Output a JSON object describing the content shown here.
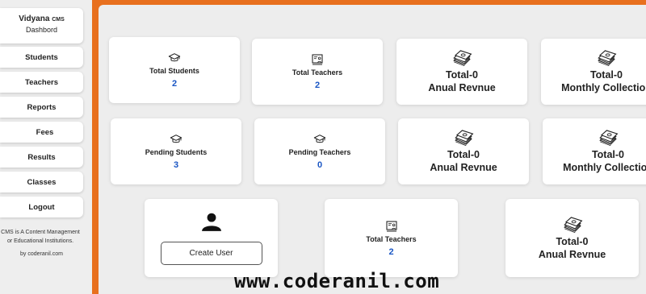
{
  "sidebar": {
    "brand_name": "Vidyana",
    "brand_suffix": "CMS",
    "brand_sub": "Dashbord",
    "items": [
      {
        "label": "Students"
      },
      {
        "label": "Teachers"
      },
      {
        "label": "Reports"
      },
      {
        "label": "Fees"
      },
      {
        "label": "Results"
      },
      {
        "label": "Classes"
      },
      {
        "label": "Logout"
      }
    ],
    "about_line1": "CMS is A Content Management",
    "about_line2": "or Educational Institutions.",
    "byline": "by coderanil.com"
  },
  "cards": {
    "total_students": {
      "label": "Total Students",
      "value": "2",
      "icon": "graduation-cap-icon"
    },
    "total_teachers": {
      "label": "Total Teachers",
      "value": "2",
      "icon": "chalkboard-teacher-icon"
    },
    "annual_revenue": {
      "line1": "Total-0",
      "line2": "Anual Revnue",
      "icon": "money-stack-icon"
    },
    "monthly_collection": {
      "line1": "Total-0",
      "line2": "Monthly Collection",
      "icon": "money-stack-icon"
    },
    "pending_students": {
      "label": "Pending Students",
      "value": "3",
      "icon": "graduation-cap-icon"
    },
    "pending_teachers": {
      "label": "Pending Teachers",
      "value": "0",
      "icon": "graduation-cap-icon"
    },
    "annual_revenue_2": {
      "line1": "Total-0",
      "line2": "Anual Revnue",
      "icon": "money-stack-icon"
    },
    "monthly_collection_2": {
      "line1": "Total-0",
      "line2": "Monthly Collection",
      "icon": "money-stack-icon"
    },
    "create_user": {
      "button_label": "Create User",
      "icon": "user-icon"
    },
    "total_teachers_2": {
      "label": "Total Teachers",
      "value": "2",
      "icon": "chalkboard-teacher-icon"
    },
    "annual_revenue_3": {
      "line1": "Total-0",
      "line2": "Anual Revnue",
      "icon": "money-stack-icon"
    }
  },
  "watermark": "www.coderanil.com",
  "colors": {
    "frame": "#e8701e",
    "accent_value": "#1a56c4",
    "background": "#ededed"
  }
}
